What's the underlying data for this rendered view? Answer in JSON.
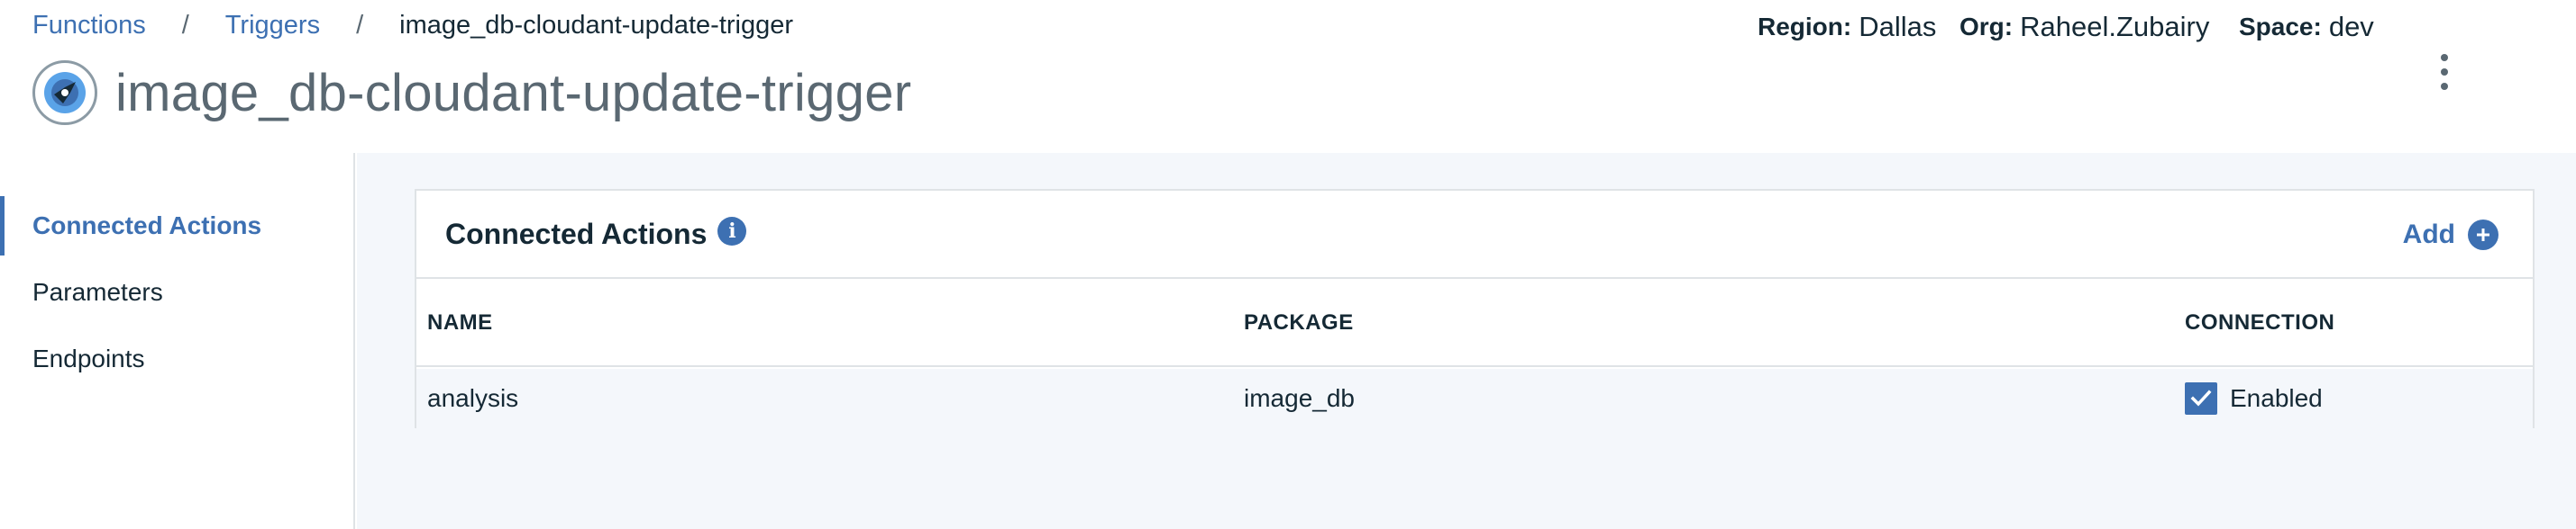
{
  "breadcrumb": {
    "items": [
      "Functions",
      "Triggers"
    ],
    "separator": "/",
    "current": "image_db-cloudant-update-trigger"
  },
  "header": {
    "title": "image_db-cloudant-update-trigger",
    "region_label": "Region:",
    "region_value": "Dallas",
    "org_label": "Org:",
    "org_value": "Raheel.Zubairy",
    "space_label": "Space:",
    "space_value": "dev"
  },
  "sidebar": {
    "items": [
      {
        "label": "Connected Actions",
        "active": true
      },
      {
        "label": "Parameters",
        "active": false
      },
      {
        "label": "Endpoints",
        "active": false
      }
    ]
  },
  "panel": {
    "title": "Connected Actions",
    "info_icon": "i",
    "add_label": "Add",
    "columns": [
      "NAME",
      "PACKAGE",
      "CONNECTION"
    ],
    "rows": [
      {
        "name": "analysis",
        "package": "image_db",
        "connection": "Enabled",
        "checked": true
      }
    ]
  },
  "colors": {
    "accent": "#3d70b2",
    "text": "#152935",
    "muted": "#5a6872",
    "background": "#f4f7fb",
    "border": "#dfe3e6"
  },
  "icons": {
    "trigger": "cloud-trigger-icon",
    "info": "info-icon",
    "add": "add-circle-icon",
    "overflow": "overflow-menu-icon",
    "checkbox": "checkmark-icon"
  }
}
